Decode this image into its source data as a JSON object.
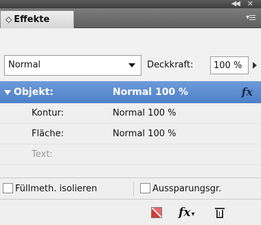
{
  "panel": {
    "tab_label": "Effekte"
  },
  "controls": {
    "blend_mode": "Normal",
    "opacity_label": "Deckkraft:",
    "opacity_value": "100 %"
  },
  "effects": {
    "object": {
      "name": "Objekt:",
      "value": "Normal 100 %"
    },
    "stroke": {
      "name": "Kontur:",
      "value": "Normal 100 %"
    },
    "fill": {
      "name": "Fläche:",
      "value": "Normal 100 %"
    },
    "text": {
      "name": "Text:",
      "value": ""
    }
  },
  "options": {
    "isolate_label": "Füllmeth. isolieren",
    "knockout_label": "Aussparungsgr."
  },
  "icons": {
    "collapse": "double-left-arrow-icon",
    "close": "close-icon",
    "menu": "panel-menu-icon",
    "fx": "fx-icon",
    "clear": "clear-effects-icon",
    "trash": "trash-icon"
  },
  "colors": {
    "selection": "#5a89d0",
    "text_disabled": "#9a9a9a"
  }
}
